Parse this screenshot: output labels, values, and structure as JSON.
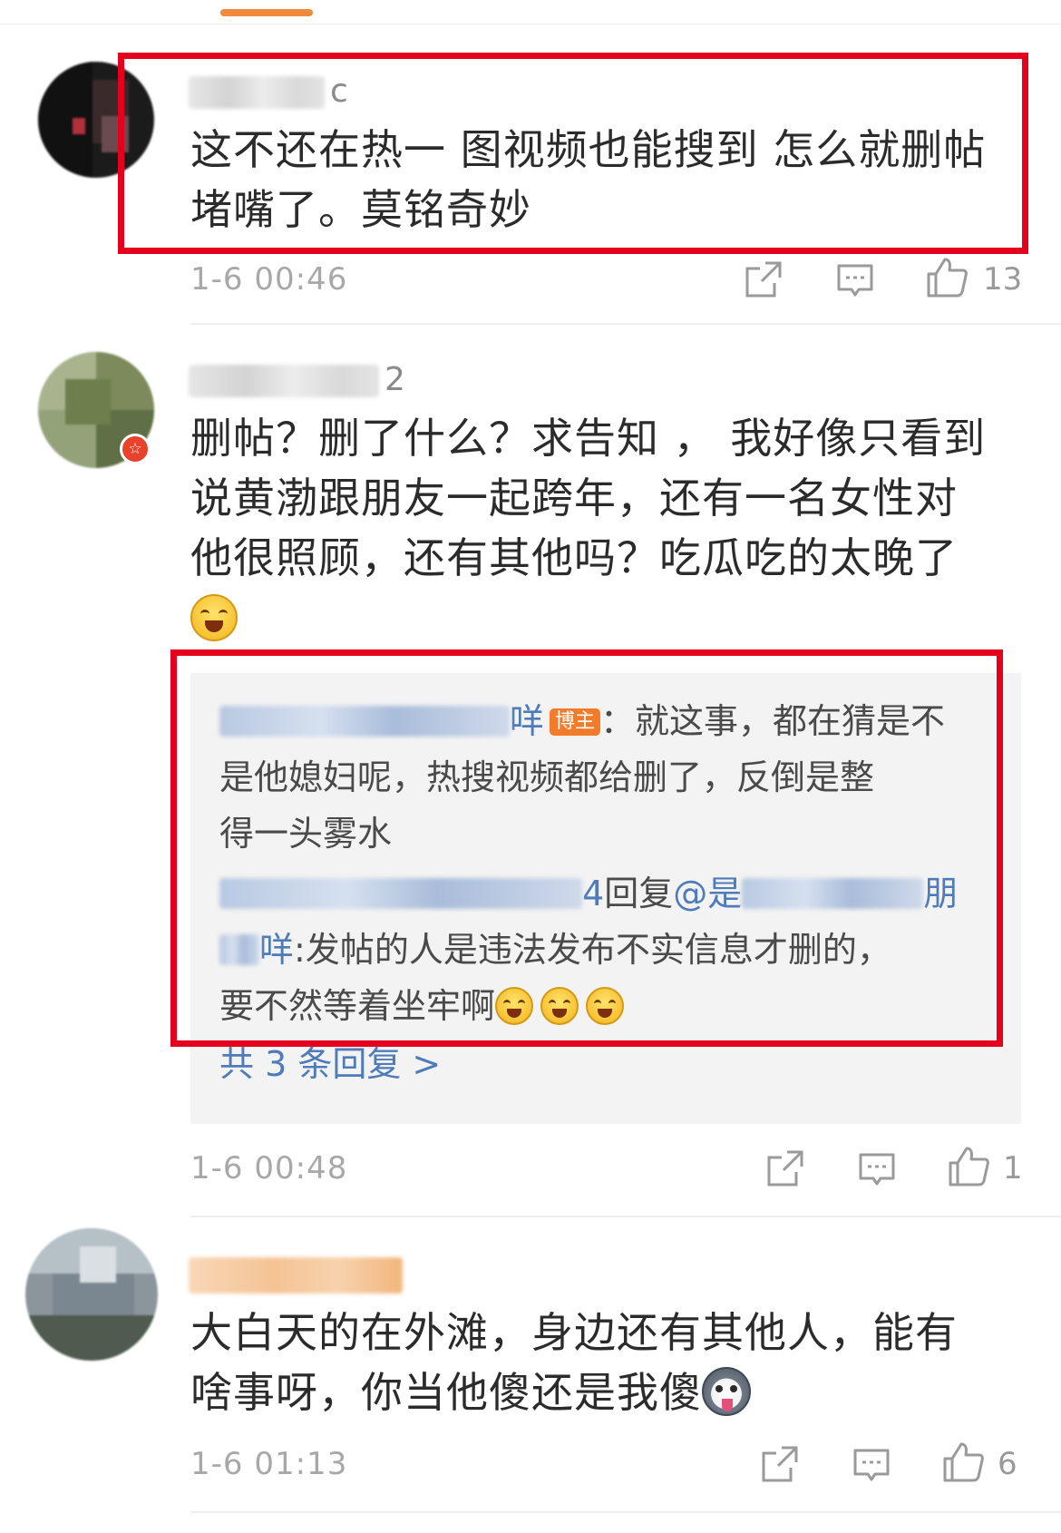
{
  "comments": [
    {
      "username_visible_part": "c",
      "text_line1": "这不还在热一 图视频也能搜到 怎么就删帖",
      "text_line2": "堵嘴了。莫铭奇妙",
      "time": "1-6 00:46",
      "likes": "13",
      "avatar_icon": "avatar-pixelated"
    },
    {
      "username_visible_part": "2",
      "text_line1": "删帖？删了什么？求告知 ， 我好像只看到",
      "text_line2": "说黄渤跟朋友一起跨年，还有一名女性对",
      "text_line3": "他很照顾，还有其他吗？吃瓜吃的太晚了",
      "emoji": "laughing-crying-emoji",
      "verified_badge": "☆",
      "time": "1-6 00:48",
      "likes": "1",
      "replies": {
        "reply1_name_visible": "咩",
        "reply1_badge": "博主",
        "reply1_text_a": "：就这事，都在猜是不",
        "reply1_text_b": "是他媳妇呢，热搜视频都给删了，反倒是整",
        "reply1_text_c": "得一头雾水",
        "reply2_prefix_visible": "4",
        "reply2_reply_word": "回复",
        "reply2_at": "@是",
        "reply2_at_tail": "朋",
        "reply2_name_tail": "咩",
        "reply2_text_a": ":发帖的人是违法发布不实信息才删的，",
        "reply2_text_b": "要不然等着坐牢啊",
        "more_label": "共 3 条回复 >"
      }
    },
    {
      "text_line1": "大白天的在外滩，身边还有其他人，能有",
      "text_line2": "啥事呀，你当他傻还是我傻",
      "emoji": "husky-emoji",
      "time": "1-6 01:13",
      "likes": "6"
    }
  ],
  "colors": {
    "accent_orange": "#f08a3c",
    "highlight_red": "#e5001d",
    "link_blue": "#4f7cb8"
  }
}
